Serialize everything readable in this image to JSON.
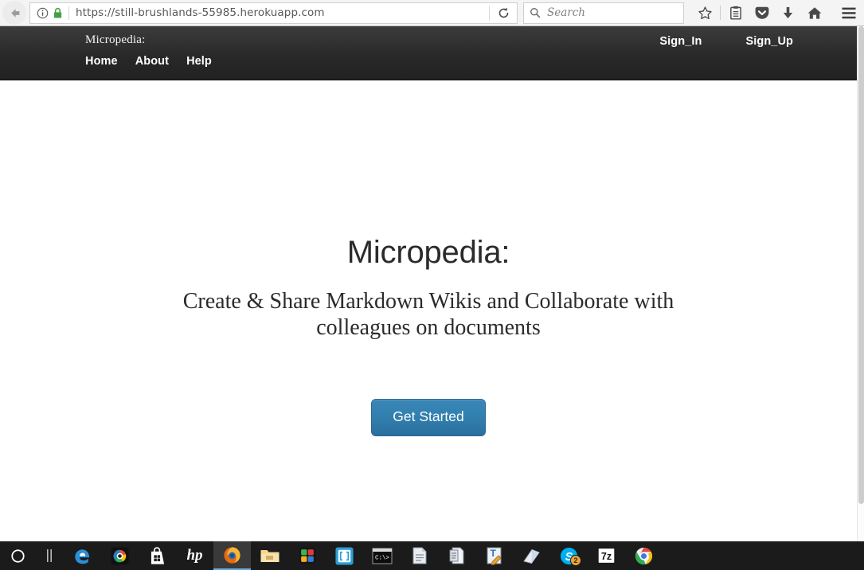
{
  "browser": {
    "name": "firefox",
    "url": "https://still-brushlands-55985.herokuapp.com",
    "search_placeholder": "Search",
    "back_icon": "back-arrow-icon",
    "info_icon": "page-info-icon",
    "lock_icon": "secure-lock-icon",
    "reload_icon": "reload-icon",
    "search_icon": "search-icon",
    "lock_color": "#43a047",
    "toolbar_buttons": [
      {
        "name": "bookmark-star-icon",
        "label": "Bookmark"
      },
      {
        "name": "library-icon",
        "label": "Library"
      },
      {
        "name": "pocket-icon",
        "label": "Pocket"
      },
      {
        "name": "downloads-icon",
        "label": "Downloads"
      },
      {
        "name": "home-icon",
        "label": "Home"
      },
      {
        "name": "menu-hamburger-icon",
        "label": "Open menu"
      }
    ]
  },
  "site": {
    "navbar": {
      "brand": "Micropedia:",
      "links": [
        {
          "label": "Home"
        },
        {
          "label": "About"
        },
        {
          "label": "Help"
        }
      ],
      "auth_links": [
        {
          "label": "Sign_In"
        },
        {
          "label": "Sign_Up"
        }
      ],
      "background": "#282828"
    },
    "hero": {
      "title": "Micropedia:",
      "lead": "Create & Share Markdown Wikis and Collaborate with colleagues on documents",
      "cta_label": "Get Started",
      "cta_color": "#3280af"
    }
  },
  "taskbar": {
    "items": [
      {
        "name": "cortana-search-icon",
        "label": "Cortana"
      },
      {
        "name": "task-view-icon",
        "label": "Task View"
      },
      {
        "name": "edge-browser-icon",
        "label": "Microsoft Edge"
      },
      {
        "name": "camera-app-icon",
        "label": "Camera"
      },
      {
        "name": "microsoft-store-icon",
        "label": "Microsoft Store"
      },
      {
        "name": "hp-support-icon",
        "label": "HP"
      },
      {
        "name": "firefox-browser-icon",
        "label": "Mozilla Firefox"
      },
      {
        "name": "file-explorer-icon",
        "label": "File Explorer"
      },
      {
        "name": "puzzle-app-icon",
        "label": "App"
      },
      {
        "name": "brackets-editor-icon",
        "label": "Brackets"
      },
      {
        "name": "command-prompt-icon",
        "label": "Command Prompt"
      },
      {
        "name": "notes-app-icon",
        "label": "Notes"
      },
      {
        "name": "document-app-icon",
        "label": "Document"
      },
      {
        "name": "text-editor-icon",
        "label": "Text Editor"
      },
      {
        "name": "onenote-icon",
        "label": "OneNote"
      },
      {
        "name": "skype-icon",
        "label": "Skype",
        "badge": "2"
      },
      {
        "name": "sevenzip-icon",
        "label": "7-Zip"
      },
      {
        "name": "chrome-browser-icon",
        "label": "Google Chrome"
      }
    ]
  }
}
